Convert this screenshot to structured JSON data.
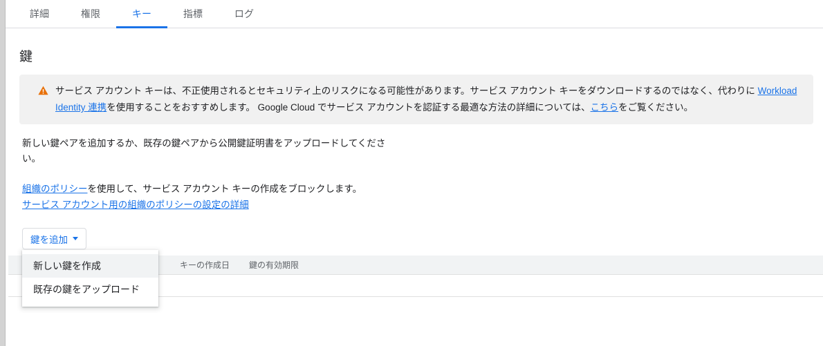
{
  "tabs": [
    {
      "label": "詳細",
      "active": false
    },
    {
      "label": "権限",
      "active": false
    },
    {
      "label": "キー",
      "active": true
    },
    {
      "label": "指標",
      "active": false
    },
    {
      "label": "ログ",
      "active": false
    }
  ],
  "page": {
    "title": "鍵"
  },
  "banner": {
    "icon": "warning-triangle-icon",
    "icon_color": "#e8710a",
    "background": "#f1f1f1",
    "text_part1": "サービス アカウント キーは、不正使用されるとセキュリティ上のリスクになる可能性があります。サービス アカウント キーをダウンロードするのではなく、代わりに ",
    "link1": "Workload Identity 連携",
    "text_part2": "を使用することをおすすめします。 Google Cloud でサービス アカウントを認証する最適な方法の詳細については、",
    "link2": "こちら",
    "text_part3": "をご覧ください。"
  },
  "description": {
    "paragraph": "新しい鍵ペアを追加するか、既存の鍵ペアから公開鍵証明書をアップロードしてください。"
  },
  "policy": {
    "link1": "組織のポリシー",
    "text_after_link1": "を使用して、サービス アカウント キーの作成をブロックします。",
    "link2": "サービス アカウント用の組織のポリシーの設定の詳細"
  },
  "toolbar": {
    "add_key_label": "鍵を追加",
    "caret_icon": "chevron-down-icon"
  },
  "dropdown": {
    "open": true,
    "items": [
      {
        "label": "新しい鍵を作成",
        "hovered": true
      },
      {
        "label": "既存の鍵をアップロード",
        "hovered": false
      }
    ]
  },
  "table": {
    "columns": [
      {
        "key": "type",
        "label": ""
      },
      {
        "key": "status",
        "label": ""
      },
      {
        "key": "keyid",
        "label": ""
      },
      {
        "key": "created",
        "label": "キーの作成日"
      },
      {
        "key": "expires",
        "label": "鍵の有効期限"
      }
    ],
    "rows": []
  },
  "colors": {
    "accent_blue": "#1a73e8",
    "warning_orange": "#e8710a",
    "banner_gray": "#f1f1f1",
    "table_header_gray": "#f1f3f4",
    "border_gray": "#dadce0",
    "text_primary": "#202124",
    "text_secondary": "#5f6368"
  }
}
